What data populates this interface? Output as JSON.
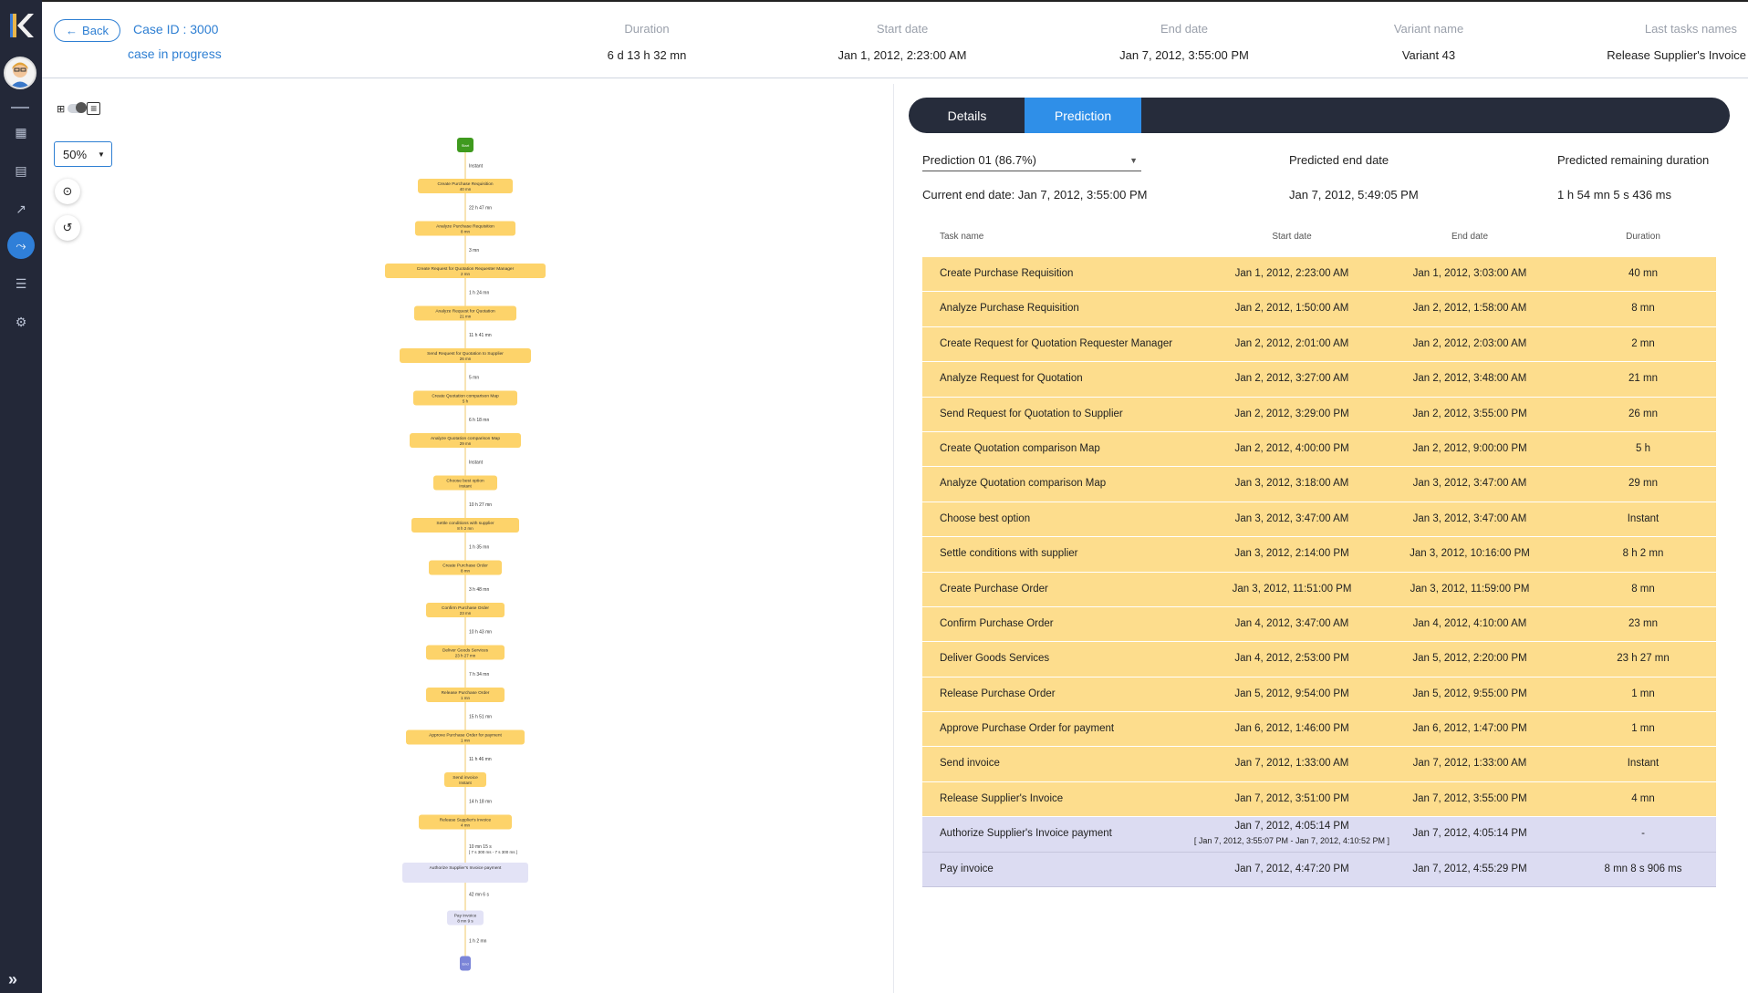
{
  "header": {
    "back_label": "Back",
    "case_id": "Case ID : 3000",
    "case_status": "case in progress",
    "columns": [
      {
        "label": "Duration",
        "value": "6 d 13 h 32 mn"
      },
      {
        "label": "Start date",
        "value": "Jan 1, 2012, 2:23:00 AM"
      },
      {
        "label": "End date",
        "value": "Jan 7, 2012, 3:55:00 PM"
      },
      {
        "label": "Variant name",
        "value": "Variant 43"
      },
      {
        "label": "Last tasks names",
        "value": "Release Supplier's Invoice"
      }
    ]
  },
  "nav": {
    "items": [
      "grid-icon",
      "dashboard-icon",
      "trend-icon",
      "process-icon",
      "list-icon",
      "settings-icon"
    ],
    "active_item": "process-icon",
    "accent": "#2f7fd8"
  },
  "left_pane": {
    "zoom_value": "50%"
  },
  "graph": {
    "start_label": "Start",
    "end_label": "End",
    "nodes": [
      {
        "label": "Create Purchase Requisition",
        "sub": "40 mn",
        "state": "done"
      },
      {
        "label": "Analyze Purchase Requisition",
        "sub": "8 mn",
        "state": "done"
      },
      {
        "label": "Create Request for Quotation Requester Manager",
        "sub": "2 mn",
        "state": "done"
      },
      {
        "label": "Analyze Request for Quotation",
        "sub": "21 mn",
        "state": "done"
      },
      {
        "label": "Send Request for Quotation to Supplier",
        "sub": "26 mn",
        "state": "done"
      },
      {
        "label": "Create Quotation comparison Map",
        "sub": "5 h",
        "state": "done"
      },
      {
        "label": "Analyze Quotation comparison Map",
        "sub": "29 mn",
        "state": "done"
      },
      {
        "label": "Choose best option",
        "sub": "Instant",
        "state": "done"
      },
      {
        "label": "Settle conditions with supplier",
        "sub": "8 h 2 mn",
        "state": "done"
      },
      {
        "label": "Create Purchase Order",
        "sub": "8 mn",
        "state": "done"
      },
      {
        "label": "Confirm Purchase Order",
        "sub": "23 mn",
        "state": "done"
      },
      {
        "label": "Deliver Goods Services",
        "sub": "23 h 27 mn",
        "state": "done"
      },
      {
        "label": "Release Purchase Order",
        "sub": "1 mn",
        "state": "done"
      },
      {
        "label": "Approve Purchase Order for payment",
        "sub": "1 mn",
        "state": "done"
      },
      {
        "label": "Send invoice",
        "sub": "Instant",
        "state": "done"
      },
      {
        "label": "Release Supplier's Invoice",
        "sub": "4 mn",
        "state": "done"
      },
      {
        "label": "Authorize Supplier's Invoice payment",
        "sub": "",
        "state": "pred"
      },
      {
        "label": "Pay invoice",
        "sub": "8 mn 9 s",
        "state": "pred"
      }
    ],
    "edges": [
      "Instant",
      "22 h 47 mn",
      "3 mn",
      "1 h 24 mn",
      "11 h 41 mn",
      "5 mn",
      "6 h 18 mn",
      "Instant",
      "10 h 27 mn",
      "1 h 35 mn",
      "3 h 48 mn",
      "10 h 43 mn",
      "7 h 34 mn",
      "15 h 51 mn",
      "11 h 46 mn",
      "14 h 18 mn",
      "10 mn 15 s",
      "42 mn 6 s",
      "1 h 2 mn"
    ],
    "edge_range_note": "[ 7 s 300 ms - 7 s 300 ms ]"
  },
  "tabs": {
    "details": "Details",
    "prediction": "Prediction"
  },
  "prediction": {
    "selector_value": "Prediction 01 (86.7%)",
    "current_end_label": "Current end date: Jan 7, 2012, 3:55:00 PM",
    "predicted_end_label": "Predicted end date",
    "predicted_end_value": "Jan 7, 2012, 5:49:05 PM",
    "remaining_label": "Predicted remaining duration",
    "remaining_value": "1 h 54 mn 5 s 436 ms"
  },
  "table": {
    "headers": [
      "Task name",
      "Start date",
      "End date",
      "Duration"
    ],
    "rows": [
      {
        "task": "Create Purchase Requisition",
        "start": "Jan 1, 2012, 2:23:00 AM",
        "end": "Jan 1, 2012, 3:03:00 AM",
        "duration": "40 mn",
        "state": "done"
      },
      {
        "task": "Analyze Purchase Requisition",
        "start": "Jan 2, 2012, 1:50:00 AM",
        "end": "Jan 2, 2012, 1:58:00 AM",
        "duration": "8 mn",
        "state": "done"
      },
      {
        "task": "Create Request for Quotation Requester Manager",
        "start": "Jan 2, 2012, 2:01:00 AM",
        "end": "Jan 2, 2012, 2:03:00 AM",
        "duration": "2 mn",
        "state": "done"
      },
      {
        "task": "Analyze Request for Quotation",
        "start": "Jan 2, 2012, 3:27:00 AM",
        "end": "Jan 2, 2012, 3:48:00 AM",
        "duration": "21 mn",
        "state": "done"
      },
      {
        "task": "Send Request for Quotation to Supplier",
        "start": "Jan 2, 2012, 3:29:00 PM",
        "end": "Jan 2, 2012, 3:55:00 PM",
        "duration": "26 mn",
        "state": "done"
      },
      {
        "task": "Create Quotation comparison Map",
        "start": "Jan 2, 2012, 4:00:00 PM",
        "end": "Jan 2, 2012, 9:00:00 PM",
        "duration": "5 h",
        "state": "done"
      },
      {
        "task": "Analyze Quotation comparison Map",
        "start": "Jan 3, 2012, 3:18:00 AM",
        "end": "Jan 3, 2012, 3:47:00 AM",
        "duration": "29 mn",
        "state": "done"
      },
      {
        "task": "Choose best option",
        "start": "Jan 3, 2012, 3:47:00 AM",
        "end": "Jan 3, 2012, 3:47:00 AM",
        "duration": "Instant",
        "state": "done"
      },
      {
        "task": "Settle conditions with supplier",
        "start": "Jan 3, 2012, 2:14:00 PM",
        "end": "Jan 3, 2012, 10:16:00 PM",
        "duration": "8 h 2 mn",
        "state": "done"
      },
      {
        "task": "Create Purchase Order",
        "start": "Jan 3, 2012, 11:51:00 PM",
        "end": "Jan 3, 2012, 11:59:00 PM",
        "duration": "8 mn",
        "state": "done"
      },
      {
        "task": "Confirm Purchase Order",
        "start": "Jan 4, 2012, 3:47:00 AM",
        "end": "Jan 4, 2012, 4:10:00 AM",
        "duration": "23 mn",
        "state": "done"
      },
      {
        "task": "Deliver Goods Services",
        "start": "Jan 4, 2012, 2:53:00 PM",
        "end": "Jan 5, 2012, 2:20:00 PM",
        "duration": "23 h 27 mn",
        "state": "done"
      },
      {
        "task": "Release Purchase Order",
        "start": "Jan 5, 2012, 9:54:00 PM",
        "end": "Jan 5, 2012, 9:55:00 PM",
        "duration": "1 mn",
        "state": "done"
      },
      {
        "task": "Approve Purchase Order for payment",
        "start": "Jan 6, 2012, 1:46:00 PM",
        "end": "Jan 6, 2012, 1:47:00 PM",
        "duration": "1 mn",
        "state": "done"
      },
      {
        "task": "Send invoice",
        "start": "Jan 7, 2012, 1:33:00 AM",
        "end": "Jan 7, 2012, 1:33:00 AM",
        "duration": "Instant",
        "state": "done"
      },
      {
        "task": "Release Supplier's Invoice",
        "start": "Jan 7, 2012, 3:51:00 PM",
        "end": "Jan 7, 2012, 3:55:00 PM",
        "duration": "4 mn",
        "state": "done"
      },
      {
        "task": "Authorize Supplier's Invoice payment",
        "start": "Jan 7, 2012, 4:05:14 PM",
        "start_range": "[ Jan 7, 2012, 3:55:07 PM - Jan 7, 2012, 4:10:52 PM ]",
        "end": "Jan 7, 2012, 4:05:14 PM",
        "duration": "-",
        "state": "pred"
      },
      {
        "task": "Pay invoice",
        "start": "Jan 7, 2012, 4:47:20 PM",
        "end": "Jan 7, 2012, 4:55:29 PM",
        "duration": "8 mn 8 s 906 ms",
        "state": "pred"
      }
    ]
  },
  "colors": {
    "done": "#fddd8d",
    "pred": "#dcdcf2",
    "accent": "#2f8fe8",
    "node_done": "#fdd36a",
    "node_pred": "#e3e3f6",
    "start_node": "#3f9a1e",
    "end_node": "#7b85d8"
  }
}
